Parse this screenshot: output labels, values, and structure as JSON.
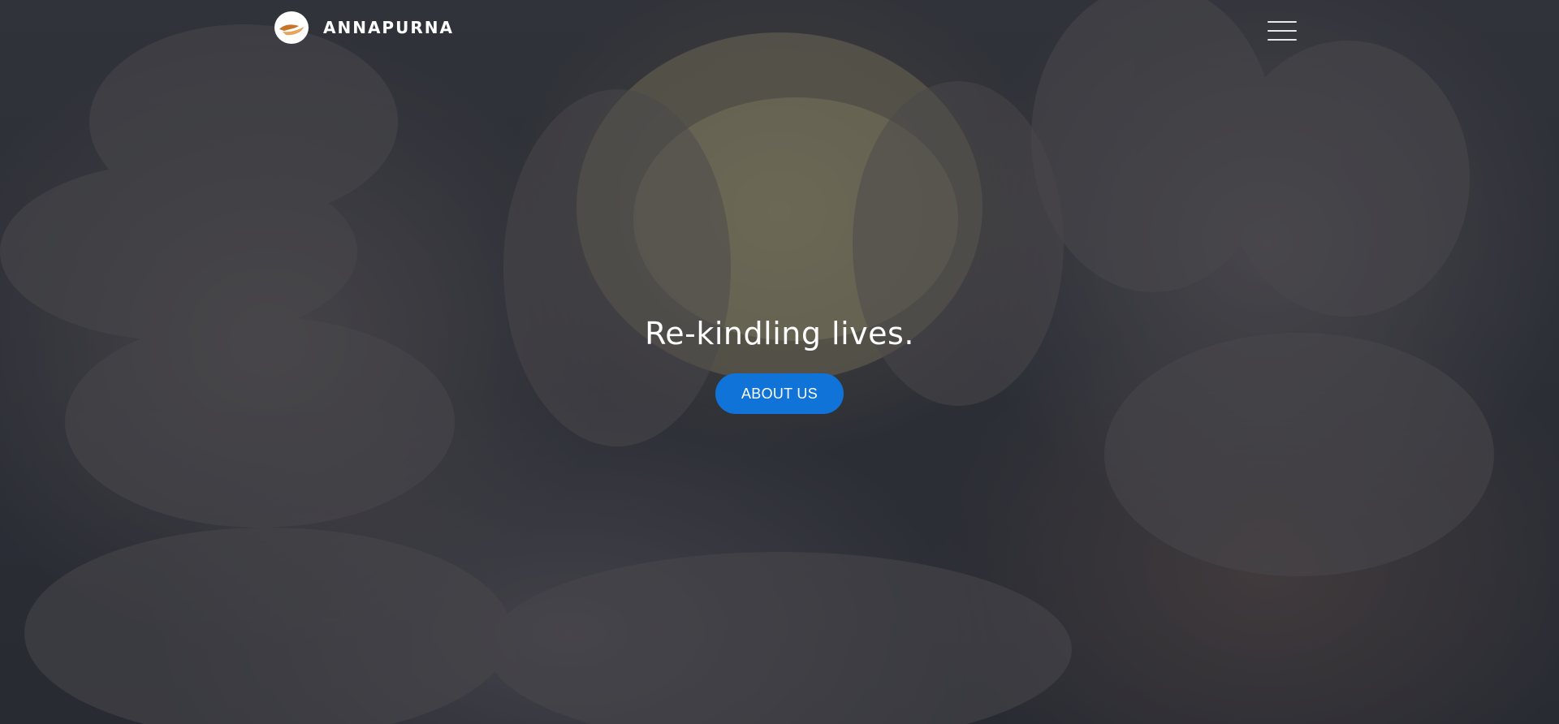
{
  "brand": {
    "name": "ANNAPURNA",
    "logo_icon": "hands-logo-icon"
  },
  "navbar": {
    "menu_icon": "hamburger-menu-icon"
  },
  "hero": {
    "background": "cupped-hands-with-grain-photo",
    "title": "Re-kindling lives.",
    "cta_label": "ABOUT US"
  },
  "colors": {
    "accent": "#0f73d8",
    "text": "#ffffff",
    "overlay": "#161a22"
  }
}
